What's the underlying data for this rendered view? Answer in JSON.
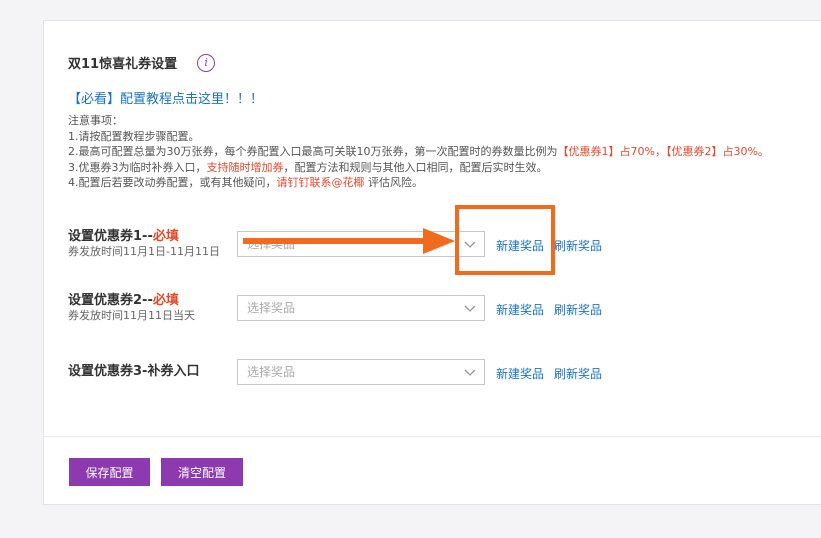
{
  "panel": {
    "title": "双11惊喜礼券设置",
    "info_icon": "i",
    "tutorial_link": "【必看】配置教程点击这里！！！"
  },
  "notes": {
    "heading": "注意事项：",
    "line1": "1.请按配置教程步骤配置。",
    "line2_a": "2.最高可配置总量为30万张券，每个券配置入口最高可关联10万张券，第一次配置时的券数量比例为",
    "line2_red1": "【优惠券1】占70%，",
    "line2_red2": "【优惠券2】占30%。",
    "line3_a": "3.优惠券3为临时补券入口，",
    "line3_red": "支持随时增加券",
    "line3_b": "，配置方法和规则与其他入口相同，配置后实时生效。",
    "line4_a": "4.配置后若要改动券配置，或有其他疑问，",
    "line4_red": "请钉钉联系@花椰",
    "line4_b": " 评估风险。"
  },
  "coupons": [
    {
      "label": "设置优惠券1--",
      "required": "必填",
      "subtext": "券发放时间11月1日-11月11日",
      "placeholder": "选择奖品",
      "new_label": "新建奖品",
      "refresh_label": "刷新奖品"
    },
    {
      "label": "设置优惠券2--",
      "required": "必填",
      "subtext": "券发放时间11月11日当天",
      "placeholder": "选择奖品",
      "new_label": "新建奖品",
      "refresh_label": "刷新奖品"
    },
    {
      "label": "设置优惠券3-补券入口",
      "placeholder": "选择奖品",
      "new_label": "新建奖品",
      "refresh_label": "刷新奖品"
    }
  ],
  "footer": {
    "save_label": "保存配置",
    "clear_label": "清空配置"
  },
  "colors": {
    "accent": "#8d3ab0",
    "link": "#1a73c9",
    "required": "#e8482a",
    "annotation": "#f26a1b"
  }
}
